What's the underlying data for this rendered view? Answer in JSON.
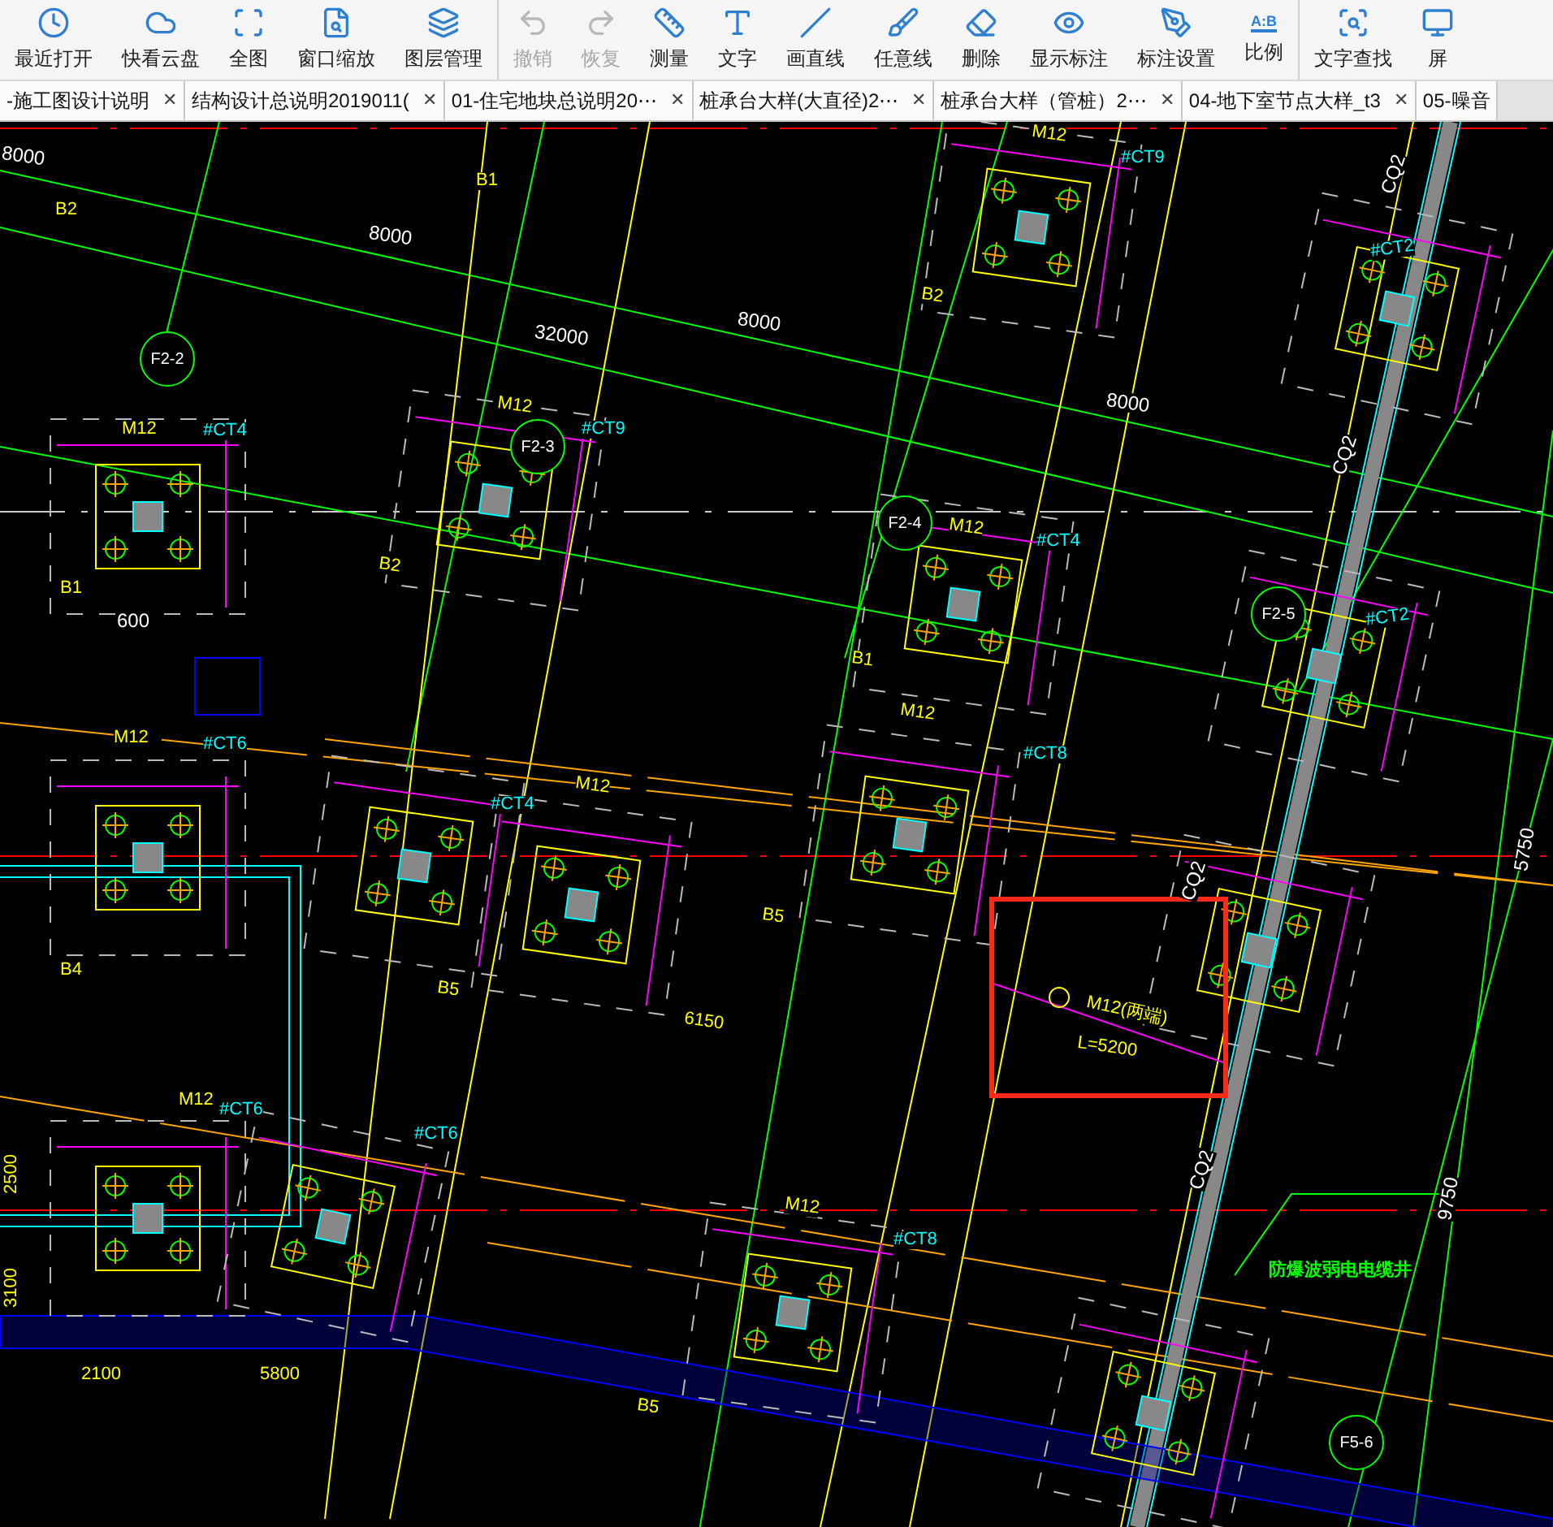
{
  "toolbar": {
    "groups": [
      [
        {
          "label": "最近打开",
          "disabled": false
        },
        {
          "label": "快看云盘",
          "disabled": false
        },
        {
          "label": "全图",
          "disabled": false
        },
        {
          "label": "窗口缩放",
          "disabled": false
        },
        {
          "label": "图层管理",
          "disabled": false
        }
      ],
      [
        {
          "label": "撤销",
          "disabled": true
        },
        {
          "label": "恢复",
          "disabled": true
        },
        {
          "label": "测量",
          "disabled": false
        },
        {
          "label": "文字",
          "disabled": false
        },
        {
          "label": "画直线",
          "disabled": false
        },
        {
          "label": "任意线",
          "disabled": false
        },
        {
          "label": "删除",
          "disabled": false
        },
        {
          "label": "显示标注",
          "disabled": false
        },
        {
          "label": "标注设置",
          "disabled": false
        },
        {
          "label": "比例",
          "disabled": false,
          "glyph": "A:B"
        }
      ],
      [
        {
          "label": "文字查找",
          "disabled": false
        },
        {
          "label": "屏",
          "disabled": false
        }
      ]
    ]
  },
  "tabs": [
    {
      "title": "-施工图设计说明",
      "close": "✕"
    },
    {
      "title": "结构设计总说明2019011(",
      "close": "✕"
    },
    {
      "title": "01-住宅地块总说明20⋯",
      "close": "✕"
    },
    {
      "title": "桩承台大样(大直径)2⋯",
      "close": "✕"
    },
    {
      "title": "桩承台大样（管桩）2⋯",
      "close": "✕"
    },
    {
      "title": "04-地下室节点大样_t3",
      "close": "✕"
    },
    {
      "title": "05-噪音"
    }
  ],
  "drawing": {
    "labels": [
      {
        "text": "8000",
        "kind": "dim"
      },
      {
        "text": "B2",
        "kind": "tag"
      },
      {
        "text": "8000",
        "kind": "dim"
      },
      {
        "text": "B1",
        "kind": "tag"
      },
      {
        "text": "32000",
        "kind": "dim"
      },
      {
        "text": "8000",
        "kind": "dim"
      },
      {
        "text": "8000",
        "kind": "dim"
      },
      {
        "text": "M12",
        "kind": "tag"
      },
      {
        "text": "#CT4",
        "kind": "ref"
      },
      {
        "text": "B1",
        "kind": "tag"
      },
      {
        "text": "600",
        "kind": "dim"
      },
      {
        "text": "M12",
        "kind": "tag"
      },
      {
        "text": "#CT9",
        "kind": "ref"
      },
      {
        "text": "B2",
        "kind": "tag"
      },
      {
        "text": "M12",
        "kind": "tag"
      },
      {
        "text": "#CT9",
        "kind": "ref"
      },
      {
        "text": "B2",
        "kind": "tag"
      },
      {
        "text": "M12",
        "kind": "tag"
      },
      {
        "text": "#CT4",
        "kind": "ref"
      },
      {
        "text": "B1",
        "kind": "tag"
      },
      {
        "text": "M12",
        "kind": "tag"
      },
      {
        "text": "#CT8",
        "kind": "ref"
      },
      {
        "text": "#CT2",
        "kind": "ref"
      },
      {
        "text": "#CT2",
        "kind": "ref"
      },
      {
        "text": "CQ2",
        "kind": "dim"
      },
      {
        "text": "CQ2",
        "kind": "dim"
      },
      {
        "text": "M12",
        "kind": "tag"
      },
      {
        "text": "#CT6",
        "kind": "ref"
      },
      {
        "text": "B4",
        "kind": "tag"
      },
      {
        "text": "M12",
        "kind": "tag"
      },
      {
        "text": "#CT4",
        "kind": "ref"
      },
      {
        "text": "B5",
        "kind": "tag"
      },
      {
        "text": "6150",
        "kind": "tag"
      },
      {
        "text": "M12",
        "kind": "tag"
      },
      {
        "text": "#CT6",
        "kind": "ref"
      },
      {
        "text": "#CT6",
        "kind": "ref"
      },
      {
        "text": "2500",
        "kind": "tag"
      },
      {
        "text": "3100",
        "kind": "tag"
      },
      {
        "text": "2100",
        "kind": "tag"
      },
      {
        "text": "5800",
        "kind": "tag"
      },
      {
        "text": "B5",
        "kind": "tag"
      },
      {
        "text": "M12",
        "kind": "tag"
      },
      {
        "text": "#CT8",
        "kind": "ref"
      },
      {
        "text": "B5",
        "kind": "tag"
      },
      {
        "text": "M12(两端)",
        "kind": "tag"
      },
      {
        "text": "L=5200",
        "kind": "tag"
      },
      {
        "text": "CQ2",
        "kind": "dim"
      },
      {
        "text": "5750",
        "kind": "dim"
      },
      {
        "text": "9750",
        "kind": "dim"
      },
      {
        "text": "防爆波弱电电缆井",
        "kind": "note"
      },
      {
        "text": "CQ2",
        "kind": "dim"
      },
      {
        "text": "F2-2",
        "kind": "axis"
      },
      {
        "text": "F2-3",
        "kind": "axis"
      },
      {
        "text": "F2-4",
        "kind": "axis"
      },
      {
        "text": "F2-5",
        "kind": "axis"
      },
      {
        "text": "F5-6",
        "kind": "axis"
      }
    ]
  }
}
